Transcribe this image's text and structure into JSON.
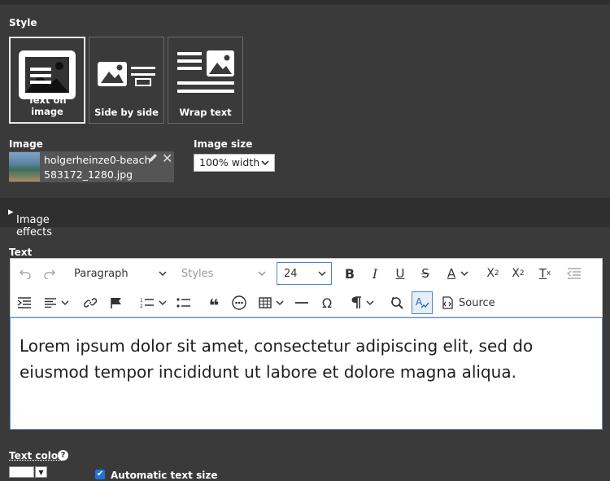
{
  "style_section": {
    "label": "Style",
    "options": [
      {
        "label": "Text on image",
        "icon": "text-on-image-icon",
        "active": true
      },
      {
        "label": "Side by side",
        "icon": "side-by-side-icon",
        "active": false
      },
      {
        "label": "Wrap text",
        "icon": "wrap-text-icon",
        "active": false
      }
    ]
  },
  "image": {
    "label": "Image",
    "filename_line1": "holgerheinze0-beach-",
    "filename_line2": "583172_1280.jpg"
  },
  "image_size": {
    "label": "Image size",
    "value": "100% width"
  },
  "image_effects": {
    "label": "Image effects"
  },
  "text_section": {
    "label": "Text",
    "toolbar": {
      "block_format": "Paragraph",
      "styles": "Styles",
      "font_size": "24",
      "source_label": "Source"
    },
    "content": "Lorem ipsum dolor sit amet, consectetur adipiscing elit, sed do eiusmod tempor incididunt ut labore et dolore magna aliqua."
  },
  "text_color": {
    "label": "Text color",
    "value": "#ffffff"
  },
  "auto_text_size": {
    "label": "Automatic text size",
    "checked": true
  },
  "colors": {
    "panel_bg": "#3a3a3a",
    "bar_bg": "#2f2f2f",
    "editor_border": "#5e93d1",
    "checkbox": "#1e73e0"
  }
}
